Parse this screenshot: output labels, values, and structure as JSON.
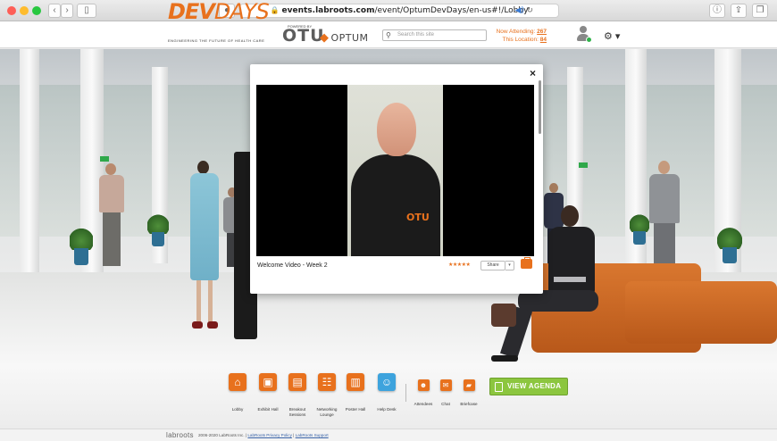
{
  "browser": {
    "url_domain": "events.labroots.com",
    "url_path": "/event/OptumDevDays/en-us#!/Lobby"
  },
  "header": {
    "logo_dev": "DEV",
    "logo_days": "DAYS",
    "logo_tagline": "ENGINEERING THE FUTURE OF HEALTH CARE",
    "logo_otu_small": "POWERED BY",
    "logo_otu": "OTU",
    "logo_optum": "OPTUM",
    "search_placeholder": "Search this site",
    "now_attending_label": "Now Attending:",
    "now_attending_value": "267",
    "this_location_label": "This Location:",
    "this_location_value": "84"
  },
  "modal": {
    "close_label": "×",
    "video_title": "Welcome Video - Week 2",
    "rating_stars": "★★★★★",
    "share_label": "Share",
    "share_caret": "▾",
    "shirt_logo": "OTU"
  },
  "nav": {
    "items": [
      {
        "label": "Lobby",
        "icon": "home-icon",
        "glyph": "⌂"
      },
      {
        "label": "Exhibit Hall",
        "icon": "exhibit-icon",
        "glyph": "▣"
      },
      {
        "label": "Breakout Sessions",
        "icon": "breakout-icon",
        "glyph": "▤"
      },
      {
        "label": "Networking Lounge",
        "icon": "networking-icon",
        "glyph": "☷"
      },
      {
        "label": "Poster Hall",
        "icon": "poster-icon",
        "glyph": "▥"
      },
      {
        "label": "Help Desk",
        "icon": "help-icon",
        "glyph": "☺"
      },
      {
        "label": "Attendees",
        "icon": "attendees-icon",
        "glyph": "☻"
      },
      {
        "label": "Chat",
        "icon": "chat-icon",
        "glyph": "✉"
      },
      {
        "label": "Briefcase",
        "icon": "briefcase-icon",
        "glyph": "▰"
      }
    ],
    "view_agenda": "VIEW AGENDA"
  },
  "footer": {
    "brand": "labroots",
    "copyright": "2006-2020 LabRoots Inc.",
    "sep": "|",
    "privacy": "LabRoots Privacy Policy",
    "support": "LabRoots Support"
  },
  "colors": {
    "brand_orange": "#e8711d",
    "agenda_green": "#8cc63f",
    "help_blue": "#3da3dd"
  }
}
